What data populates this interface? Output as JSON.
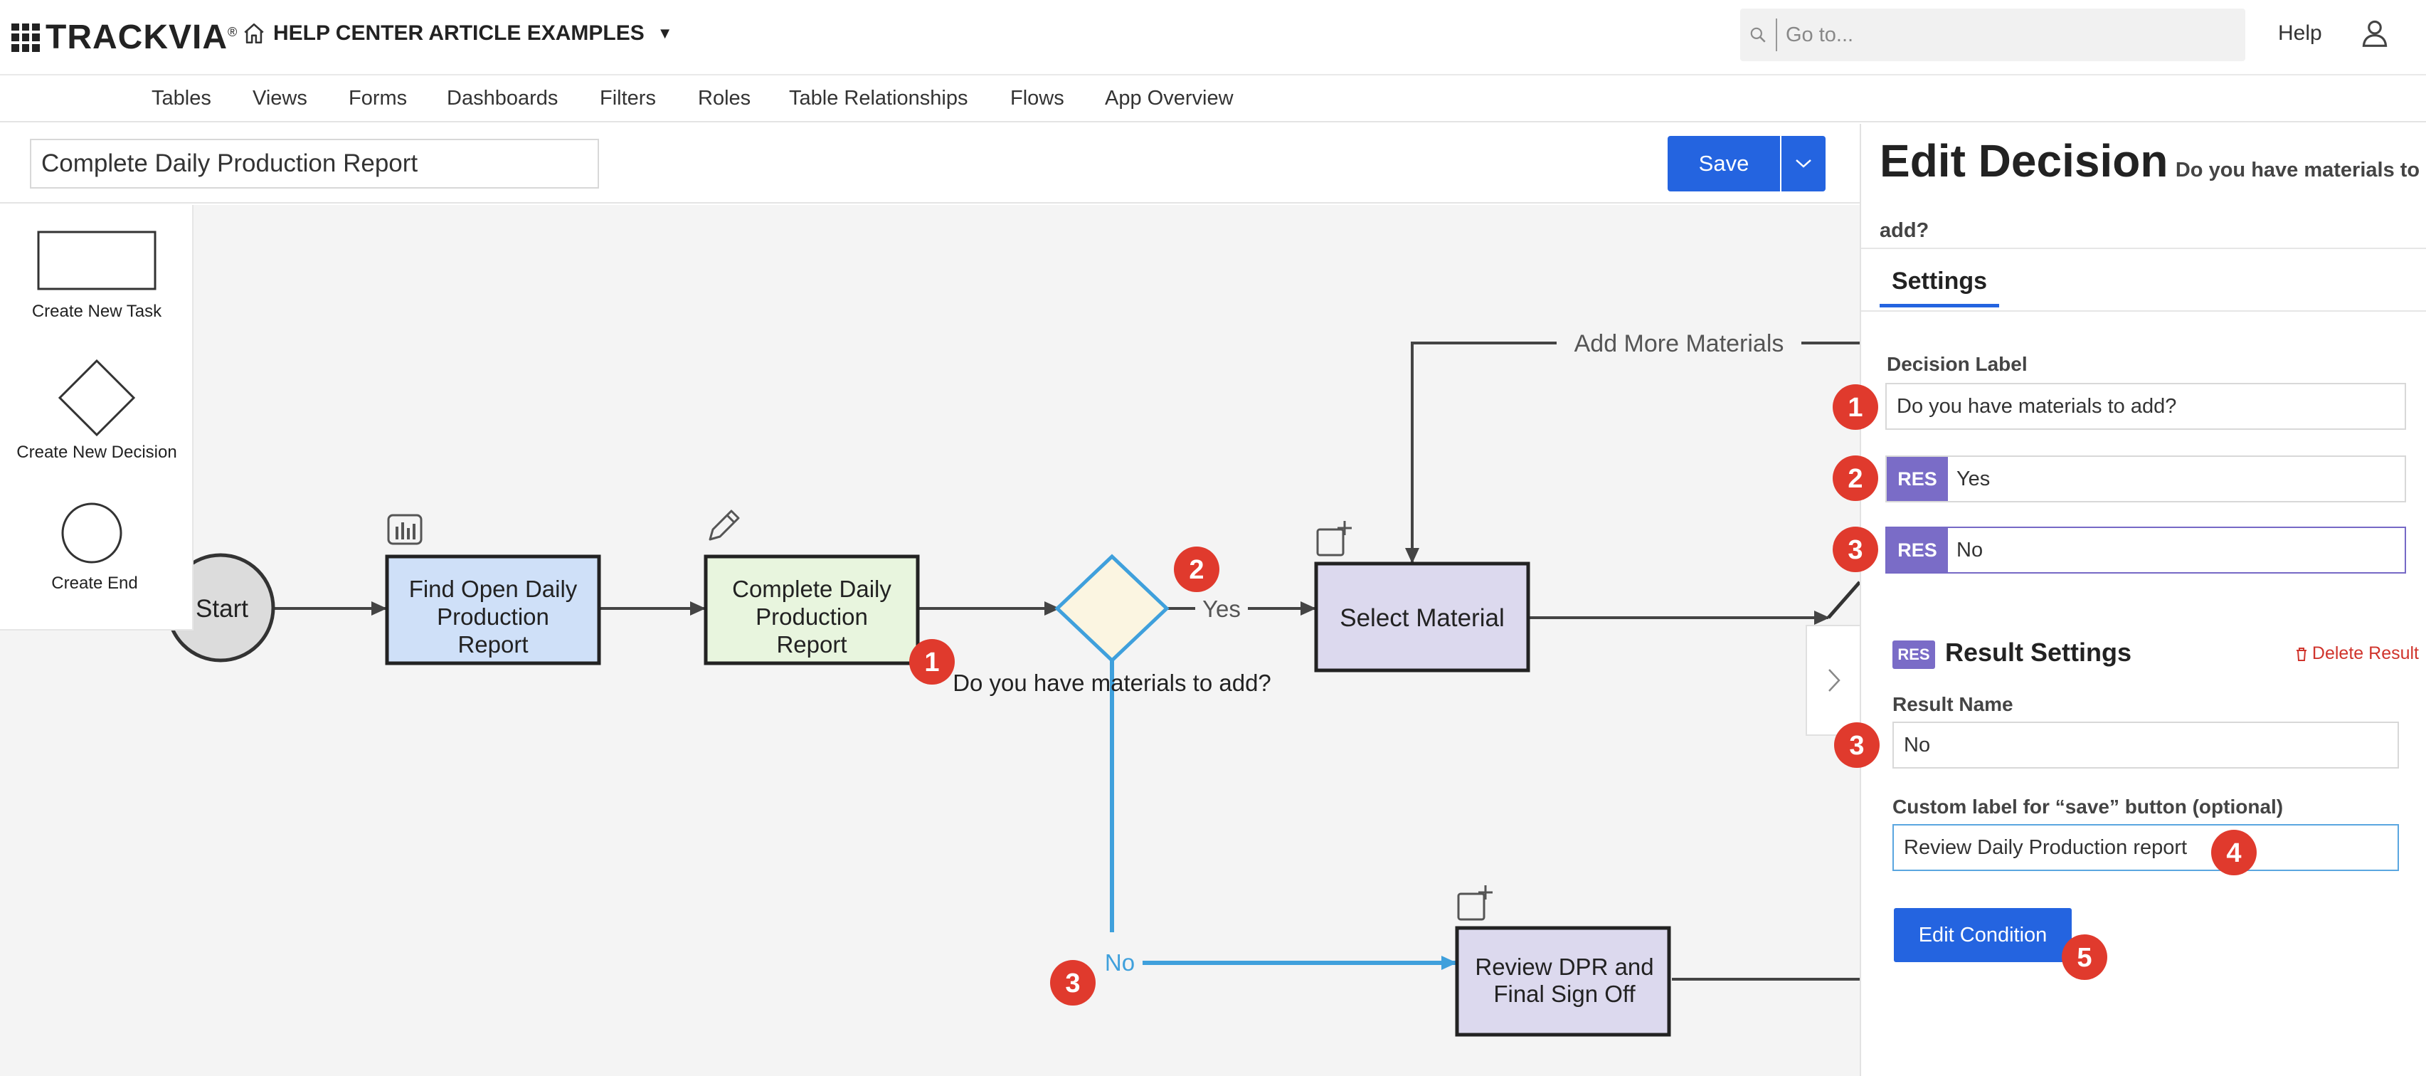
{
  "header": {
    "logo_text": "TRACKVIA",
    "logo_mark": "®",
    "app_name": "HELP CENTER ARTICLE EXAMPLES",
    "search_placeholder": "Go to...",
    "help_label": "Help"
  },
  "nav": {
    "items": [
      {
        "label": "Tables"
      },
      {
        "label": "Views"
      },
      {
        "label": "Forms"
      },
      {
        "label": "Dashboards"
      },
      {
        "label": "Filters"
      },
      {
        "label": "Roles"
      },
      {
        "label": "Table Relationships"
      },
      {
        "label": "Flows"
      },
      {
        "label": "App Overview"
      }
    ]
  },
  "toolbar": {
    "flow_name": "Complete Daily Production Report",
    "save_label": "Save"
  },
  "palette": {
    "task_label": "Create New Task",
    "decision_label": "Create New Decision",
    "end_label": "Create End"
  },
  "flow": {
    "start_label": "Start",
    "node1": [
      "Find Open Daily",
      "Production",
      "Report"
    ],
    "node2": [
      "Complete Daily",
      "Production",
      "Report"
    ],
    "decision_text": "Do you have materials to add?",
    "yes_label": "Yes",
    "no_label": "No",
    "select_material": "Select Material",
    "add_more": "Add More Materials",
    "review": [
      "Review DPR and",
      "Final Sign Off"
    ]
  },
  "panel": {
    "title": "Edit Decision",
    "subtitle": "Do you have materials to add?",
    "tab_settings": "Settings",
    "decision_label_caption": "Decision Label",
    "decision_label_value": "Do you have materials to add?",
    "res_badge": "RES",
    "result_yes": "Yes",
    "result_no": "No",
    "result_settings_title": "Result Settings",
    "delete_result": "Delete Result",
    "result_name_caption": "Result Name",
    "result_name_value": "No",
    "custom_label_caption": "Custom label for “save” button (optional)",
    "custom_label_value": "Review Daily Production report",
    "edit_condition": "Edit Condition"
  },
  "markers": {
    "m1": "1",
    "m2": "2",
    "m3": "3",
    "m4": "4",
    "m5": "5",
    "color": "#e03a2d"
  },
  "colors": {
    "accent": "#2464e0",
    "res_purple": "#7a6cc7",
    "no_path": "#3fa0dc"
  }
}
